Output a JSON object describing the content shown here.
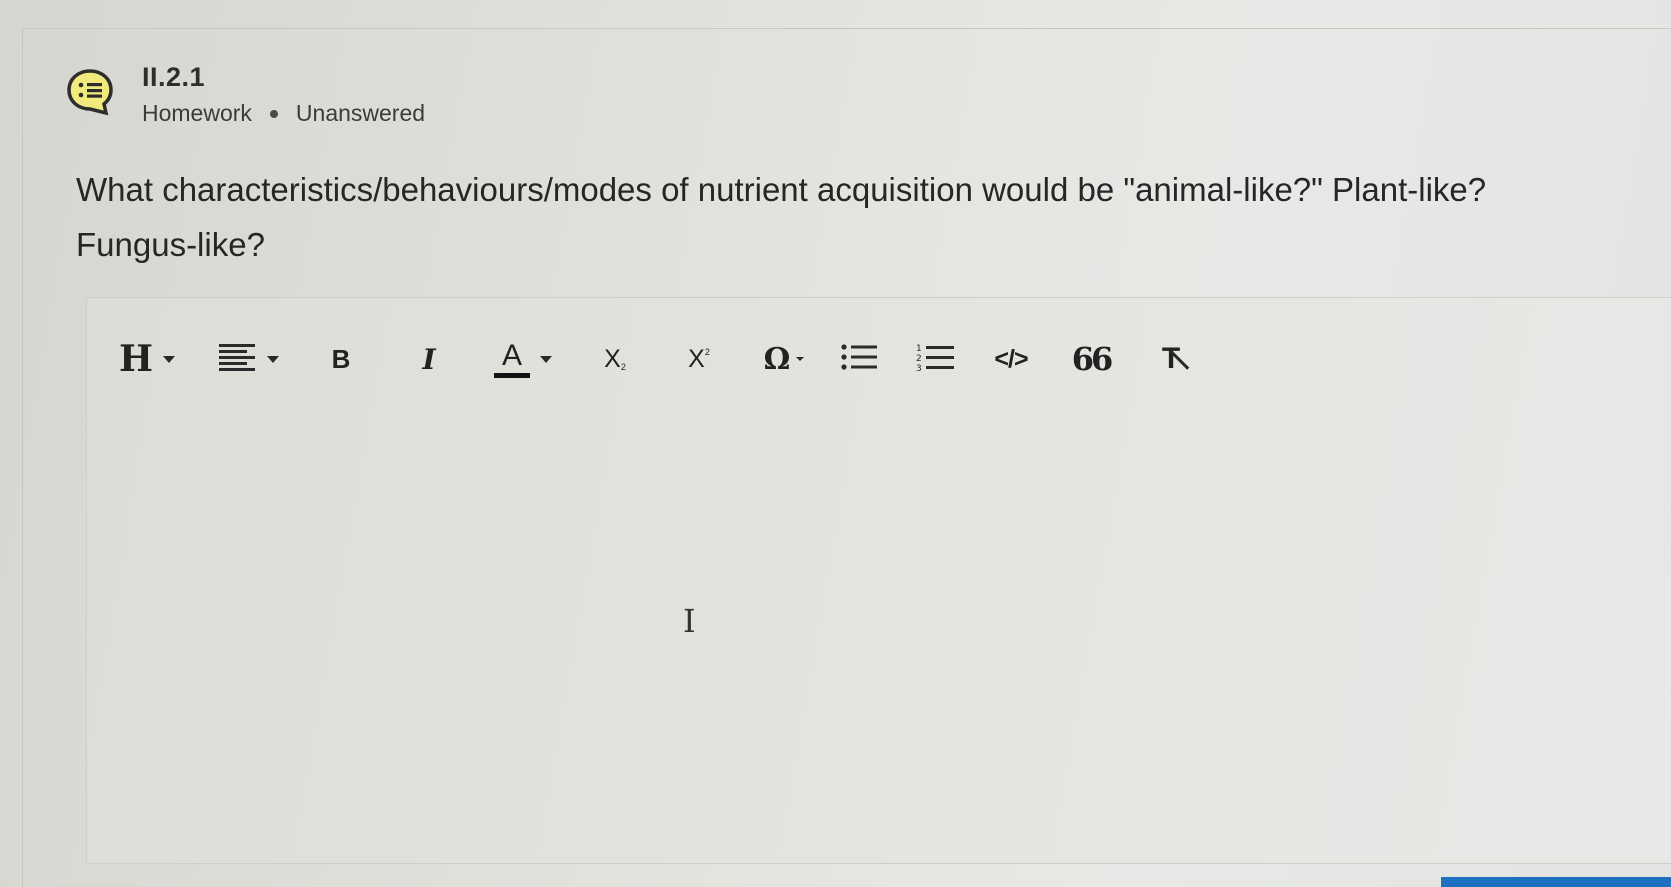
{
  "question": {
    "id": "II.2.1",
    "type": "Homework",
    "status": "Unanswered",
    "text_line1": "What characteristics/behaviours/modes of nutrient acquisition would be \"animal-like?\" Plant-like?",
    "text_line2": "Fungus-like?"
  },
  "toolbar": {
    "heading_label": "H",
    "bold_label": "B",
    "italic_label": "I",
    "font_color_label": "A",
    "subscript_label": "X",
    "subscript_mark": "2",
    "superscript_label": "X",
    "superscript_mark": "2",
    "special_char_label": "Ω",
    "quote_label": "66",
    "clear_format_label": "T",
    "code_label": "</>"
  },
  "editor": {
    "cursor_glyph": "I"
  },
  "icons": {
    "question_icon": "list-speech-bubble-icon",
    "align": "align-left-icon",
    "bulleted_list": "bulleted-list-icon",
    "numbered_list": "numbered-list-icon",
    "code": "code-icon",
    "quote": "quote-icon",
    "clear_format": "clear-format-icon"
  },
  "colors": {
    "icon_fill": "#f1ea7c",
    "accent_blue": "#1f6fc0"
  }
}
